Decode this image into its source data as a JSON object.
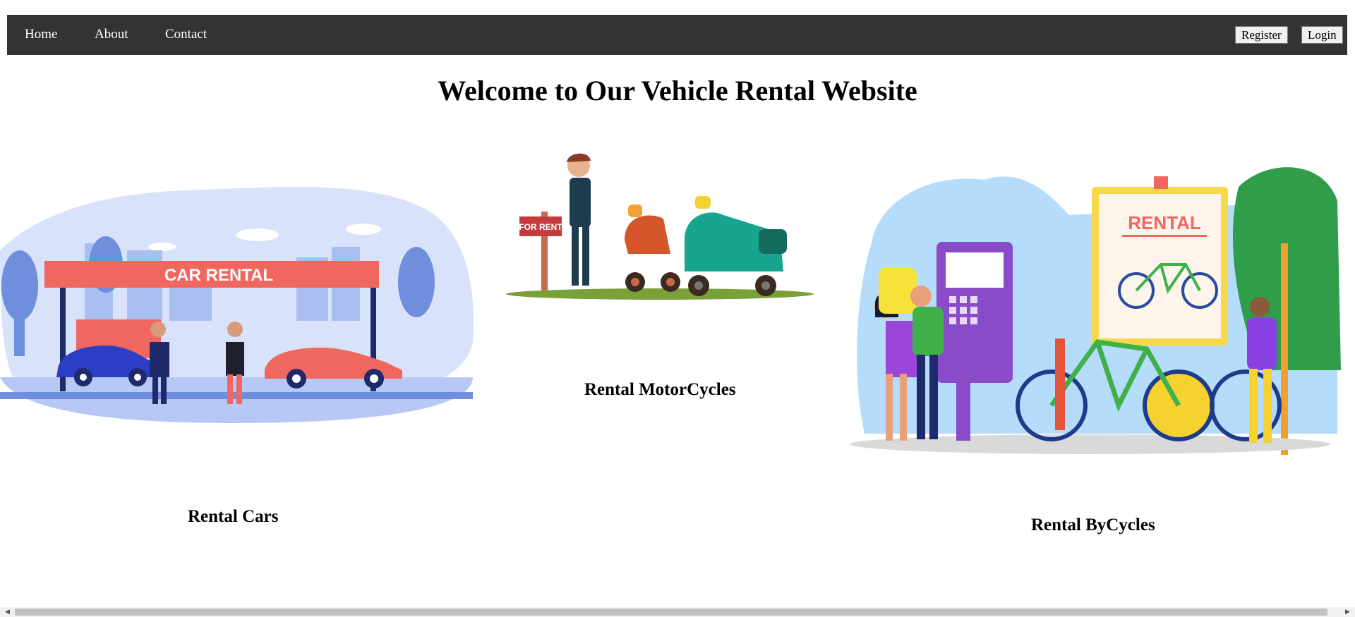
{
  "nav": {
    "home": "Home",
    "about": "About",
    "contact": "Contact",
    "register": "Register",
    "login": "Login"
  },
  "page": {
    "title": "Welcome to Our Vehicle Rental Website"
  },
  "cards": {
    "cars": {
      "caption": "Rental Cars",
      "sign": "CAR RENTAL"
    },
    "motorcycles": {
      "caption": "Rental MotorCycles",
      "sign": "FOR RENT"
    },
    "bicycles": {
      "caption": "Rental ByCycles",
      "sign": "RENTAL"
    }
  },
  "colors": {
    "navbar": "#333333",
    "accent_red": "#F0675F",
    "scrollbar_thumb": "#C1C1C1"
  }
}
